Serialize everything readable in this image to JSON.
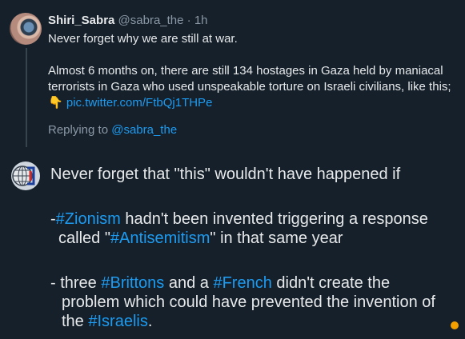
{
  "tweet": {
    "name": "Shiri_Sabra",
    "handle": "@sabra_the",
    "separator": "·",
    "time": "1h",
    "line1": "Never forget why we are still at war.",
    "line2": "Almost 6 months on, there are still 134 hostages in Gaza held by maniacal terrorists in Gaza who used unspeakable torture on Israeli civilians, like this;",
    "emoji": "👇",
    "link": "pic.twitter.com/FtbQj1THPe"
  },
  "reply": {
    "prefix": "Replying to",
    "handle": "@sabra_the"
  },
  "response": {
    "line1": "Never forget that \"this\" wouldn't have happened if",
    "b1_dash": "-",
    "b1_tag1": "#Zionism",
    "b1_text1": " hadn't been invented triggering a response",
    "b1_text2": "called \"",
    "b1_tag2": "#Antisemitism",
    "b1_text3": "\" in that same year",
    "b2_prefix": "- three ",
    "b2_tag1": "#Brittons",
    "b2_text1": " and a ",
    "b2_tag2": "#French",
    "b2_text2": " didn't create the",
    "b2_text3": "problem which could have prevented the invention of",
    "b2_text4": "the ",
    "b2_tag3": "#Israelis",
    "b2_text5": "."
  }
}
